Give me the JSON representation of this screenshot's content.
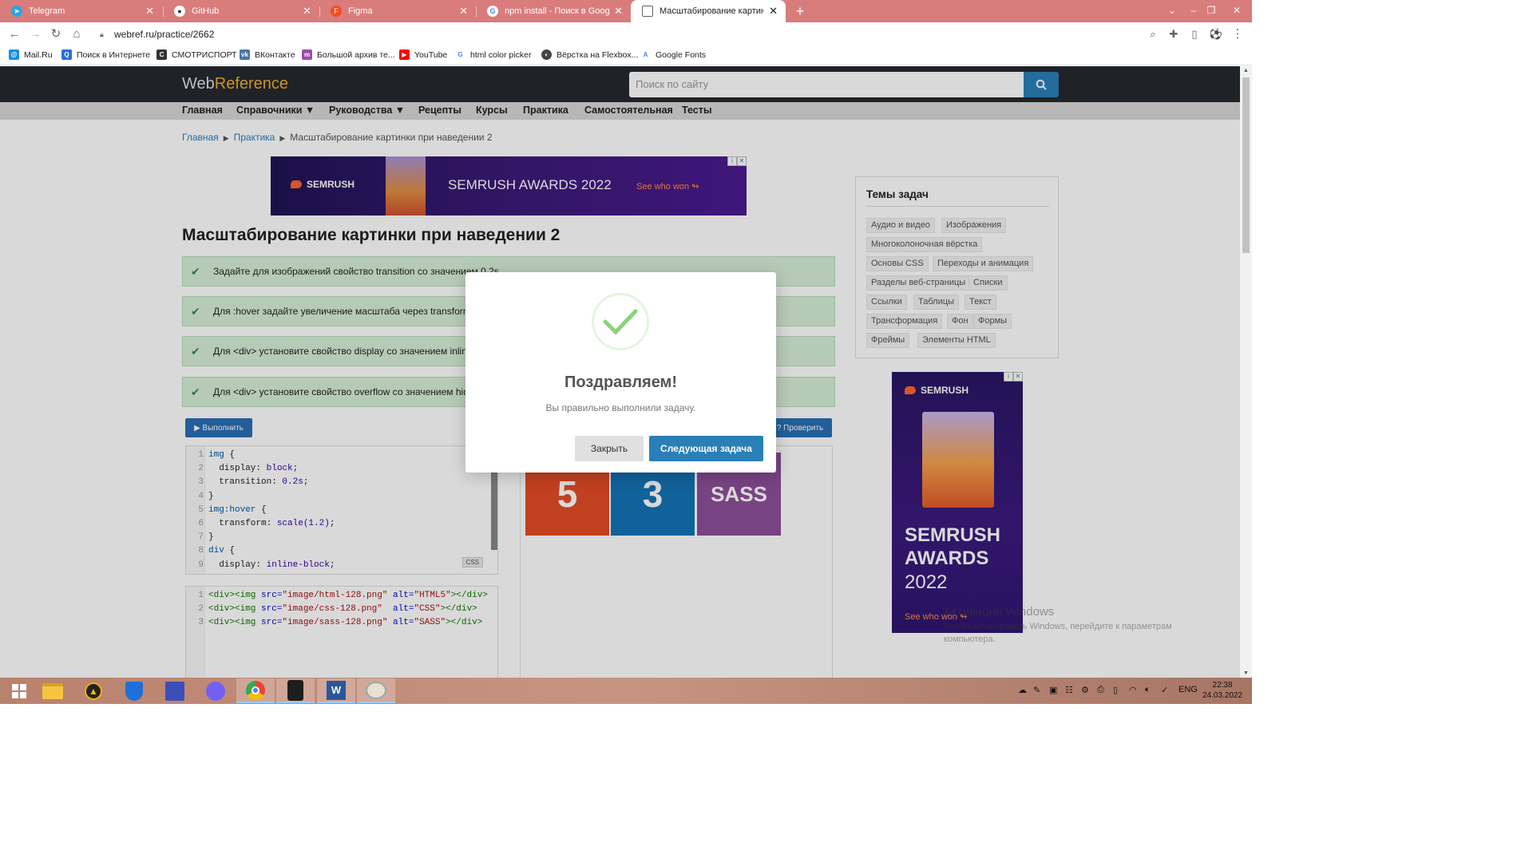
{
  "browser": {
    "tabs": [
      {
        "title": "Telegram",
        "icon": "telegram-icon",
        "color": "#2ca5e0"
      },
      {
        "title": "GitHub",
        "icon": "github-icon",
        "color": "#24292e"
      },
      {
        "title": "Figma",
        "icon": "figma-icon",
        "color": "#f24e1e"
      },
      {
        "title": "npm install - Поиск в Google",
        "icon": "google-icon",
        "color": "#4285f4"
      },
      {
        "title": "Масштабирование картинки пр",
        "icon": "page-icon",
        "color": "#5f6368"
      }
    ],
    "address": "webref.ru/practice/2662",
    "bookmarks": [
      {
        "label": "Mail.Ru",
        "icon": "mailru-icon",
        "color": "#168de2"
      },
      {
        "label": "Поиск в Интернете",
        "icon": "search-icon",
        "color": "#2a6fd8"
      },
      {
        "label": "СМОТРИСПОРТ",
        "icon": "smotrisport-icon",
        "color": "#333"
      },
      {
        "label": "ВКонтакте",
        "icon": "vk-icon",
        "color": "#4a76a8"
      },
      {
        "label": "Большой архив те...",
        "icon": "archive-icon",
        "color": "#9b4ea8"
      },
      {
        "label": "YouTube",
        "icon": "youtube-icon",
        "color": "#ff0000"
      },
      {
        "label": "html color picker",
        "icon": "google-icon",
        "color": "#4285f4"
      },
      {
        "label": "Вёрстка на Flexbox...",
        "icon": "flexbox-icon",
        "color": "#444"
      },
      {
        "label": "Google Fonts",
        "icon": "google-fonts-icon",
        "color": "#4285f4"
      }
    ]
  },
  "site": {
    "logo_web": "Web",
    "logo_ref": "Reference",
    "search_placeholder": "Поиск по сайту",
    "nav": [
      "Главная",
      "Справочники ▼",
      "Руководства ▼",
      "Рецепты",
      "Курсы",
      "Практика",
      "Самостоятельная",
      "Тесты"
    ]
  },
  "breadcrumb": {
    "home": "Главная",
    "section": "Практика",
    "current": "Масштабирование картинки при наведении 2"
  },
  "ad_banner": {
    "brand": "SEMRUSH",
    "headline": "SEMRUSH AWARDS 2022",
    "cta": "See who won ↬"
  },
  "task": {
    "title": "Масштабирование картинки при наведении 2",
    "requirements": [
      "Задайте для изображений свойство transition со значением 0.2s.",
      "Для :hover задайте увеличение масштаба через transform.",
      "Для <div> установите свойство display со значением inline-block.",
      "Для <div> установите свойство overflow со значением hidden."
    ],
    "run_label": "▶ Выполнить",
    "check_label": "? Проверить",
    "css_lang": "CSS"
  },
  "css_code": [
    {
      "n": "1",
      "parts": [
        [
          "sel",
          "img"
        ],
        [
          "prop",
          " {"
        ]
      ]
    },
    {
      "n": "2",
      "parts": [
        [
          "prop",
          "  display: "
        ],
        [
          "val",
          "block"
        ],
        [
          "prop",
          ";"
        ]
      ]
    },
    {
      "n": "3",
      "parts": [
        [
          "prop",
          "  transition: "
        ],
        [
          "val",
          "0.2s"
        ],
        [
          "prop",
          ";"
        ]
      ]
    },
    {
      "n": "4",
      "parts": [
        [
          "prop",
          "}"
        ]
      ]
    },
    {
      "n": "5",
      "parts": [
        [
          "sel",
          "img:hover"
        ],
        [
          "prop",
          " {"
        ]
      ]
    },
    {
      "n": "6",
      "parts": [
        [
          "prop",
          "  transform: "
        ],
        [
          "val",
          "scale(1.2)"
        ],
        [
          "prop",
          ";"
        ]
      ]
    },
    {
      "n": "7",
      "parts": [
        [
          "prop",
          "}"
        ]
      ]
    },
    {
      "n": "8",
      "parts": [
        [
          "sel",
          "div"
        ],
        [
          "prop",
          " {"
        ]
      ]
    },
    {
      "n": "9",
      "parts": [
        [
          "prop",
          "  display: "
        ],
        [
          "val",
          "inline-block"
        ],
        [
          "prop",
          ";"
        ]
      ]
    }
  ],
  "html_code": [
    {
      "n": "1",
      "parts": [
        [
          "tag",
          "<div><img "
        ],
        [
          "attr",
          "src="
        ],
        [
          "str",
          "\"image/html-128.png\""
        ],
        [
          "attr",
          " alt="
        ],
        [
          "str",
          "\"HTML5\""
        ],
        [
          "tag",
          "></div>"
        ]
      ]
    },
    {
      "n": "2",
      "parts": [
        [
          "tag",
          "<div><img "
        ],
        [
          "attr",
          "src="
        ],
        [
          "str",
          "\"image/css-128.png\""
        ],
        [
          "attr",
          "  alt="
        ],
        [
          "str",
          "\"CSS\""
        ],
        [
          "tag",
          "></div>"
        ]
      ]
    },
    {
      "n": "3",
      "parts": [
        [
          "tag",
          "<div><img "
        ],
        [
          "attr",
          "src="
        ],
        [
          "str",
          "\"image/sass-128.png\""
        ],
        [
          "attr",
          " alt="
        ],
        [
          "str",
          "\"SASS\""
        ],
        [
          "tag",
          "></div>"
        ]
      ]
    }
  ],
  "preview": {
    "logos": [
      {
        "label": "5",
        "name": "html5-logo",
        "color": "#e34c26"
      },
      {
        "label": "3",
        "name": "css3-logo",
        "color": "#1572b6"
      },
      {
        "label": "SASS",
        "name": "sass-logo",
        "color": "#8e4f99"
      }
    ]
  },
  "sidebar": {
    "title": "Темы задач",
    "topics": [
      "Аудио и видео",
      "Изображения",
      "Многоколоночная вёрстка",
      "Основы CSS",
      "Переходы и анимация",
      "Разделы веб-страницы",
      "Списки",
      "Ссылки",
      "Таблицы",
      "Текст",
      "Трансформация",
      "Фон",
      "Формы",
      "Фреймы",
      "Элементы HTML"
    ]
  },
  "ad_side": {
    "brand": "SEMRUSH",
    "line1": "SEMRUSH",
    "line2": "AWARDS",
    "year": "2022",
    "cta": "See who won ↬"
  },
  "modal": {
    "heading": "Поздравляем!",
    "message": "Вы правильно выполнили задачу.",
    "close_label": "Закрыть",
    "next_label": "Следующая задача"
  },
  "windows": {
    "activate_title": "Активация Windows",
    "activate_text": "Чтобы активировать Windows, перейдите к параметрам компьютера.",
    "lang": "ENG",
    "time": "22:38",
    "date": "24.03.2022"
  }
}
